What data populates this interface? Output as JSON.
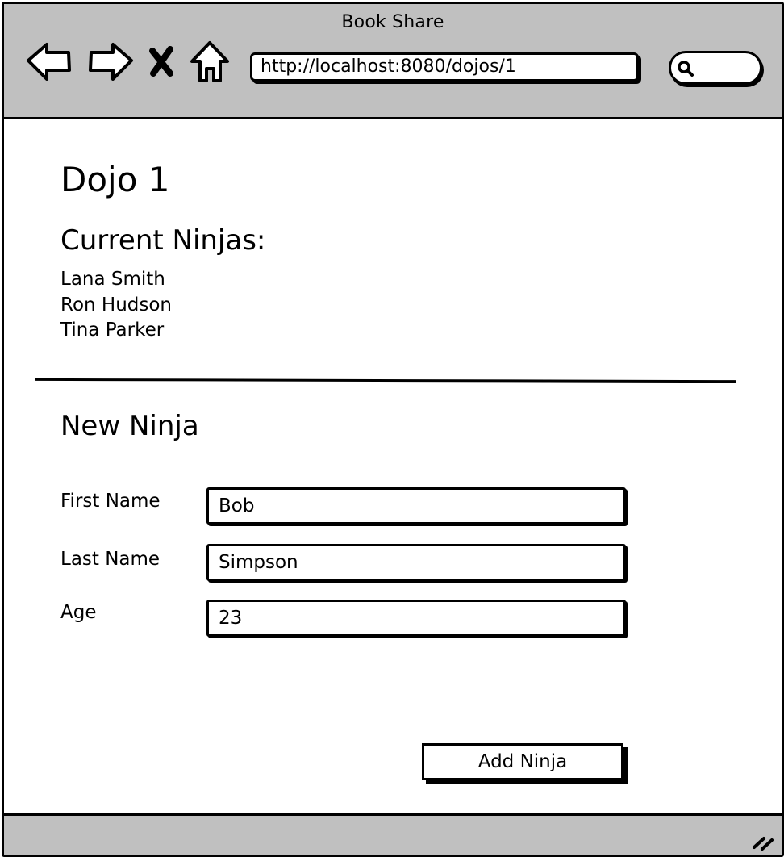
{
  "window": {
    "title": "Book Share"
  },
  "toolbar": {
    "back_icon": "arrow-left-icon",
    "forward_icon": "arrow-right-icon",
    "stop_icon": "close-icon",
    "home_icon": "home-icon",
    "url": "http://localhost:8080/dojos/1",
    "search_icon": "search-icon",
    "search_value": ""
  },
  "page": {
    "title": "Dojo 1",
    "ninjas_heading": "Current Ninjas:",
    "ninjas": [
      "Lana Smith",
      "Ron Hudson",
      "Tina Parker"
    ],
    "form": {
      "heading": "New Ninja",
      "first_name_label": "First Name",
      "first_name_value": "Bob",
      "last_name_label": "Last Name",
      "last_name_value": "Simpson",
      "age_label": "Age",
      "age_value": "23",
      "submit_label": "Add Ninja"
    }
  },
  "status_bar": {
    "resize_icon": "resize-grip-icon"
  },
  "colors": {
    "chrome": "#c0c0c0",
    "background": "#ffffff",
    "ink": "#000000"
  }
}
